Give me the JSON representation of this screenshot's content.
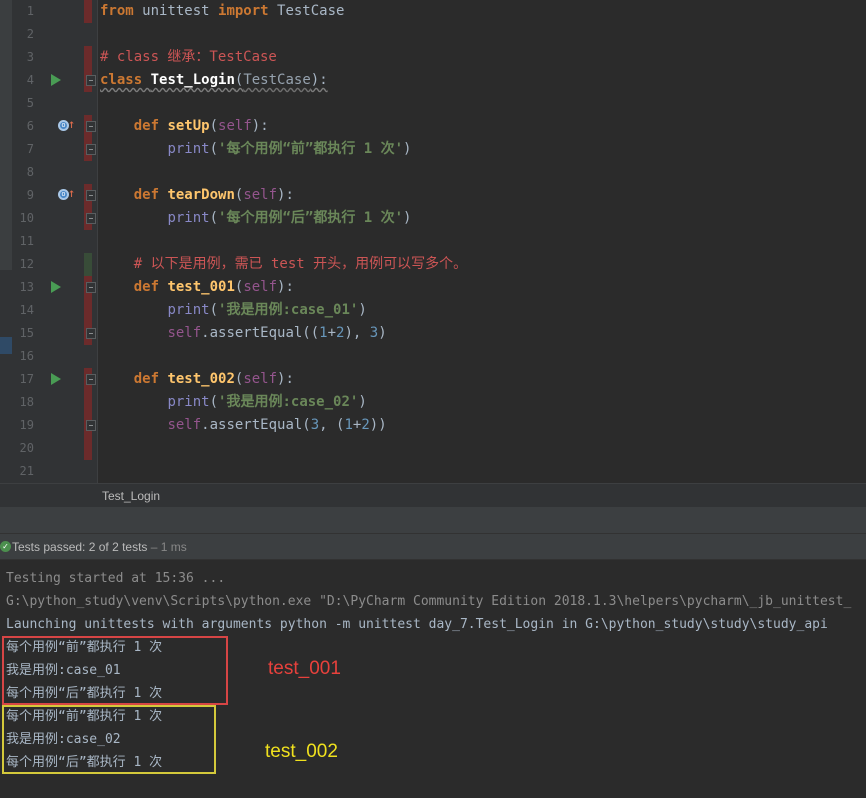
{
  "editor": {
    "lines": [
      {
        "n": "1",
        "tokens": [
          {
            "t": "from",
            "c": "kw"
          },
          {
            "t": " unittest ",
            "c": ""
          },
          {
            "t": "import",
            "c": "kw"
          },
          {
            "t": " TestCase",
            "c": ""
          }
        ]
      },
      {
        "n": "2",
        "tokens": []
      },
      {
        "n": "3",
        "tokens": [
          {
            "t": "# class 继承：TestCase",
            "c": "cmt-red"
          }
        ]
      },
      {
        "n": "4",
        "tokens": [
          {
            "t": "class",
            "c": "kw squig"
          },
          {
            "t": " ",
            "c": "squig"
          },
          {
            "t": "Test_Login",
            "c": "cls squig"
          },
          {
            "t": "(",
            "c": "squig"
          },
          {
            "t": "TestCase",
            "c": "base squig"
          },
          {
            "t": "):",
            "c": "squig"
          }
        ]
      },
      {
        "n": "5",
        "tokens": []
      },
      {
        "n": "6",
        "tokens": [
          {
            "t": "    ",
            "c": ""
          },
          {
            "t": "def",
            "c": "kw"
          },
          {
            "t": " ",
            "c": ""
          },
          {
            "t": "setUp",
            "c": "fn"
          },
          {
            "t": "(",
            "c": ""
          },
          {
            "t": "self",
            "c": "self"
          },
          {
            "t": "):",
            "c": ""
          }
        ]
      },
      {
        "n": "7",
        "tokens": [
          {
            "t": "        ",
            "c": ""
          },
          {
            "t": "print",
            "c": "bi"
          },
          {
            "t": "(",
            "c": ""
          },
          {
            "t": "'每个用例“前”都执行 1 次'",
            "c": "str"
          },
          {
            "t": ")",
            "c": ""
          }
        ]
      },
      {
        "n": "8",
        "tokens": []
      },
      {
        "n": "9",
        "tokens": [
          {
            "t": "    ",
            "c": ""
          },
          {
            "t": "def",
            "c": "kw"
          },
          {
            "t": " ",
            "c": ""
          },
          {
            "t": "tearDown",
            "c": "fn"
          },
          {
            "t": "(",
            "c": ""
          },
          {
            "t": "self",
            "c": "self"
          },
          {
            "t": "):",
            "c": ""
          }
        ]
      },
      {
        "n": "10",
        "tokens": [
          {
            "t": "        ",
            "c": ""
          },
          {
            "t": "print",
            "c": "bi"
          },
          {
            "t": "(",
            "c": ""
          },
          {
            "t": "'每个用例“后”都执行 1 次'",
            "c": "str"
          },
          {
            "t": ")",
            "c": ""
          }
        ]
      },
      {
        "n": "11",
        "tokens": []
      },
      {
        "n": "12",
        "tokens": [
          {
            "t": "    ",
            "c": ""
          },
          {
            "t": "# 以下是用例，需已 test 开头，用例可以写多个。",
            "c": "cmt-red"
          }
        ]
      },
      {
        "n": "13",
        "tokens": [
          {
            "t": "    ",
            "c": ""
          },
          {
            "t": "def",
            "c": "kw"
          },
          {
            "t": " ",
            "c": ""
          },
          {
            "t": "test_001",
            "c": "fn"
          },
          {
            "t": "(",
            "c": ""
          },
          {
            "t": "self",
            "c": "self"
          },
          {
            "t": "):",
            "c": ""
          }
        ]
      },
      {
        "n": "14",
        "tokens": [
          {
            "t": "        ",
            "c": ""
          },
          {
            "t": "print",
            "c": "bi"
          },
          {
            "t": "(",
            "c": ""
          },
          {
            "t": "'我是用例:case_01'",
            "c": "str"
          },
          {
            "t": ")",
            "c": ""
          }
        ]
      },
      {
        "n": "15",
        "tokens": [
          {
            "t": "        ",
            "c": ""
          },
          {
            "t": "self",
            "c": "self"
          },
          {
            "t": ".assertEqual((",
            "c": ""
          },
          {
            "t": "1",
            "c": "num"
          },
          {
            "t": "+",
            "c": ""
          },
          {
            "t": "2",
            "c": "num"
          },
          {
            "t": "), ",
            "c": ""
          },
          {
            "t": "3",
            "c": "num"
          },
          {
            "t": ")",
            "c": ""
          }
        ]
      },
      {
        "n": "16",
        "tokens": []
      },
      {
        "n": "17",
        "tokens": [
          {
            "t": "    ",
            "c": ""
          },
          {
            "t": "def",
            "c": "kw"
          },
          {
            "t": " ",
            "c": ""
          },
          {
            "t": "test_002",
            "c": "fn"
          },
          {
            "t": "(",
            "c": ""
          },
          {
            "t": "self",
            "c": "self"
          },
          {
            "t": "):",
            "c": ""
          }
        ]
      },
      {
        "n": "18",
        "tokens": [
          {
            "t": "        ",
            "c": ""
          },
          {
            "t": "print",
            "c": "bi"
          },
          {
            "t": "(",
            "c": ""
          },
          {
            "t": "'我是用例:case_02'",
            "c": "str"
          },
          {
            "t": ")",
            "c": ""
          }
        ]
      },
      {
        "n": "19",
        "tokens": [
          {
            "t": "        ",
            "c": ""
          },
          {
            "t": "self",
            "c": "self"
          },
          {
            "t": ".assertEqual(",
            "c": ""
          },
          {
            "t": "3",
            "c": "num"
          },
          {
            "t": ", (",
            "c": ""
          },
          {
            "t": "1",
            "c": "num"
          },
          {
            "t": "+",
            "c": ""
          },
          {
            "t": "2",
            "c": "num"
          },
          {
            "t": "))",
            "c": ""
          }
        ]
      },
      {
        "n": "20",
        "tokens": []
      },
      {
        "n": "21",
        "tokens": []
      }
    ]
  },
  "breadcrumb": {
    "label": "Test_Login"
  },
  "test_status": {
    "label": "Tests passed: ",
    "passed": "2",
    "of": " of 2 tests",
    "time": " – 1 ms"
  },
  "console": {
    "lines": [
      {
        "text": "Testing started at 15:36 ...",
        "style": "con-gray"
      },
      {
        "text": "G:\\python_study\\venv\\Scripts\\python.exe \"D:\\PyCharm Community Edition 2018.1.3\\helpers\\pycharm\\_jb_unittest_",
        "style": "con-gray"
      },
      {
        "text": "Launching unittests with arguments python -m unittest day_7.Test_Login in G:\\python_study\\study\\study_api",
        "style": ""
      },
      {
        "text": "每个用例“前”都执行 1 次",
        "style": ""
      },
      {
        "text": "我是用例:case_01",
        "style": ""
      },
      {
        "text": "每个用例“后”都执行 1 次",
        "style": ""
      },
      {
        "text": "每个用例“前”都执行 1 次",
        "style": ""
      },
      {
        "text": "我是用例:case_02",
        "style": ""
      },
      {
        "text": "每个用例“后”都执行 1 次",
        "style": ""
      }
    ]
  },
  "annotations": {
    "test1": "test_001",
    "test2": "test_002"
  },
  "colors": {
    "red_box": "#d64545",
    "yellow_box": "#d4c93b"
  }
}
